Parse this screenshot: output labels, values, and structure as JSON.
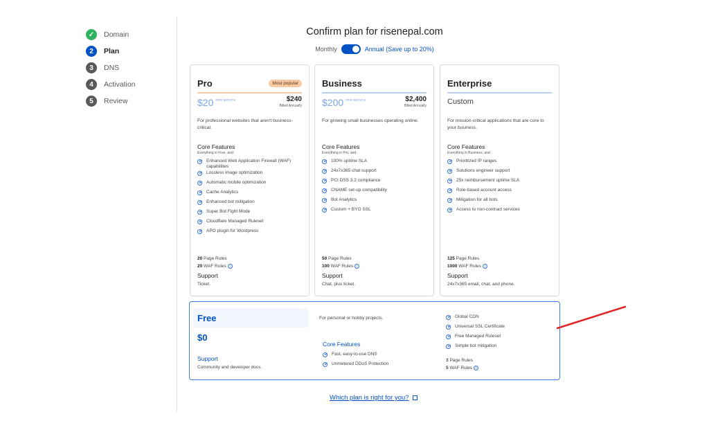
{
  "steps": [
    {
      "num": "✓",
      "label": "Domain",
      "state": "done"
    },
    {
      "num": "2",
      "label": "Plan",
      "state": "active"
    },
    {
      "num": "3",
      "label": "DNS",
      "state": "todo"
    },
    {
      "num": "4",
      "label": "Activation",
      "state": "todo"
    },
    {
      "num": "5",
      "label": "Review",
      "state": "todo"
    }
  ],
  "header": {
    "title": "Confirm plan for risenepal.com",
    "monthly_label": "Monthly",
    "annual_label": "Annual (Save up to 20%)",
    "annual_selected": true
  },
  "plans": [
    {
      "name": "Pro",
      "badge": "Most popular",
      "bar_color": "#f8c9a3",
      "price": "$20",
      "price_unit": "PER MONTH",
      "annual_price": "$240",
      "billed": "Billed Annually",
      "description": "For professional websites that aren't business-critical.",
      "core_title": "Core Features",
      "core_subtitle": "Everything in Free, and:",
      "features": [
        "Enhanced Web Application Firewall (WAF) capabilities",
        "Lossless image optimization",
        "Automatic mobile optimization",
        "Cache Analytics",
        "Enhanced bot mitigation",
        "Super Bot Fight Mode",
        "Cloudflare Managed Ruleset",
        "APO plugin for Wordpress"
      ],
      "page_rules_num": "20",
      "page_rules_label": "Page Rules",
      "waf_rules_num": "20",
      "waf_rules_label": "WAF Rules",
      "support_title": "Support",
      "support_text": "Ticket."
    },
    {
      "name": "Business",
      "bar_color": "#b7d0f2",
      "price": "$200",
      "price_unit": "PER MONTH",
      "annual_price": "$2,400",
      "billed": "Billed Annually",
      "description": "For growing small businesses operating online.",
      "core_title": "Core Features",
      "core_subtitle": "Everything in Pro, and:",
      "features": [
        "100% uptime SLA",
        "24x7x365 chat support",
        "PCI DSS 3.2 compliance",
        "CNAME set-up compatibility",
        "Bot Analytics",
        "Custom + BYO SSL"
      ],
      "page_rules_num": "50",
      "page_rules_label": "Page Rules",
      "waf_rules_num": "100",
      "waf_rules_label": "WAF Rules",
      "support_title": "Support",
      "support_text": "Chat, plus ticket."
    },
    {
      "name": "Enterprise",
      "bar_color": "#b7d0f2",
      "custom_label": "Custom",
      "description": "For mission-critical applications that are core to your business.",
      "core_title": "Core Features",
      "core_subtitle": "Everything in Business, and:",
      "features": [
        "Prioritized IP ranges",
        "Solutions engineer support",
        "25x reimbursement uptime SLA",
        "Role-based account access",
        "Mitigation for all bots",
        "Access to non-contract services"
      ],
      "page_rules_num": "125",
      "page_rules_label": "Page Rules",
      "waf_rules_num": "1000",
      "waf_rules_label": "WAF Rules",
      "support_title": "Support",
      "support_text": "24x7x365 email, chat, and phone."
    }
  ],
  "free": {
    "name": "Free",
    "price": "$0",
    "support_title": "Support",
    "support_text": "Community and developer docs.",
    "description": "For personal or hobby projects.",
    "core_title": "Core Features",
    "core_features": [
      "Fast, easy-to-use DNS",
      "Unmetered DDoS Protection"
    ],
    "features": [
      "Global CDN",
      "Universal SSL Certificate",
      "Free Managed Ruleset",
      "Simple bot mitigation"
    ],
    "page_rules_num": "3",
    "page_rules_label": "Page Rules",
    "waf_rules_num": "5",
    "waf_rules_label": "WAF Rules"
  },
  "help_link": "Which plan is right for you?",
  "icons": {
    "check": "check-circle-icon",
    "info": "info-icon",
    "external": "external-link-icon"
  },
  "colors": {
    "accent": "#0051c3",
    "done": "#2db35d",
    "annotation": "#e02424"
  }
}
